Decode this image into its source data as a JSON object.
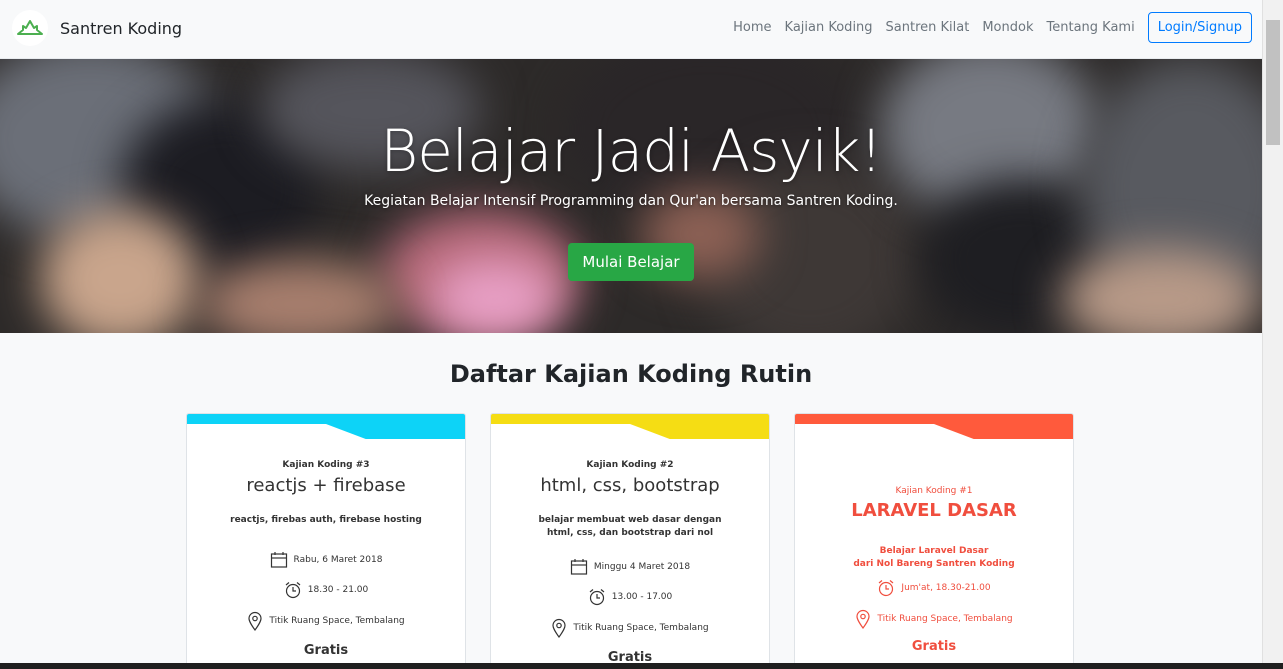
{
  "nav": {
    "brand": "Santren Koding",
    "links": [
      "Home",
      "Kajian Koding",
      "Santren Kilat",
      "Mondok",
      "Tentang Kami"
    ],
    "login": "Login/Signup"
  },
  "hero": {
    "title": "Belajar Jadi Asyik!",
    "subtitle": "Kegiatan Belajar Intensif Programming dan Qur'an bersama Santren Koding.",
    "button": "Mulai Belajar"
  },
  "section": {
    "title": "Daftar Kajian Koding Rutin"
  },
  "cards": [
    {
      "color": "#0dd3f7",
      "label": "Kajian Koding #3",
      "title": "reactjs + firebase",
      "desc1": "reactjs, firebas auth, firebase hosting",
      "desc2": "",
      "date": "Rabu,  6 Maret 2018",
      "time": "18.30 - 21.00",
      "place": "Titik Ruang Space, Tembalang",
      "price": "Gratis"
    },
    {
      "color": "#f5dd14",
      "label": "Kajian Koding #2",
      "title": "html, css, bootstrap",
      "desc1": "belajar membuat web dasar dengan",
      "desc2": "html, css, dan bootstrap dari nol",
      "date": "Minggu  4 Maret 2018",
      "time": "13.00 - 17.00",
      "place": "Titik Ruang Space, Tembalang",
      "price": "Gratis"
    },
    {
      "color": "#ff5a3c",
      "label": "Kajian Koding #1",
      "title": "LARAVEL DASAR",
      "desc1": "Belajar Laravel Dasar",
      "desc2": "dari Nol Bareng Santren Koding",
      "date": "Jum'at, 18.30-21.00",
      "place": "Titik Ruang Space, Tembalang",
      "price": "Gratis"
    }
  ]
}
